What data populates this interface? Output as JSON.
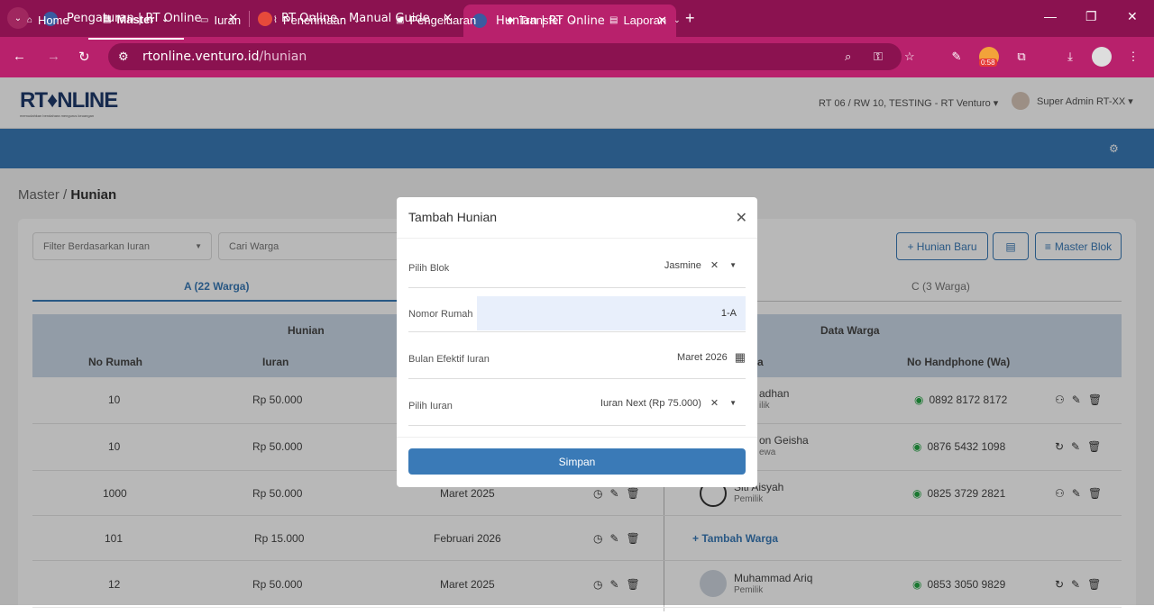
{
  "browser": {
    "tabs": [
      {
        "title": "Pengaturan | RT Online"
      },
      {
        "title": "RT Online - Manual Guide - Xm"
      },
      {
        "title": "Hunian | RT Online"
      }
    ],
    "url_host": "rtonline.venturo.id",
    "url_path": "/hunian",
    "timer": "0:58"
  },
  "app": {
    "logo": "RT♦NLINE",
    "logo_sub": "memudahkan bendahara mengurus keuangan",
    "rt_selector": "RT 06 / RW 10, TESTING - RT Venturo ▾",
    "user": "Super Admin RT-XX ▾"
  },
  "menu": [
    {
      "label": "Home"
    },
    {
      "label": "Master"
    },
    {
      "label": "Iuran"
    },
    {
      "label": "Penerimaan"
    },
    {
      "label": "Pengeluaran"
    },
    {
      "label": "Transfer"
    },
    {
      "label": "Laporan"
    }
  ],
  "breadcrumb": {
    "parent": "Master",
    "current": "Hunian"
  },
  "filters": {
    "filter_iuran": "Filter Berdasarkan Iuran",
    "search": "Cari Warga"
  },
  "buttons": {
    "new": "+ Hunian Baru",
    "master_blok": "Master Blok"
  },
  "block_tabs": [
    "A (22 Warga)",
    "C (3 Warga)"
  ],
  "table": {
    "group_hunian": "Hunian",
    "group_warga": "Data Warga",
    "col_no": "No Rumah",
    "col_iuran": "Iuran",
    "col_name": "a",
    "col_phone": "No Handphone (Wa)",
    "rows": [
      {
        "no": "10",
        "iuran": "Rp 50.000",
        "bulan": "",
        "name": "adhan",
        "role": "ilik",
        "phone": "0892 8172 8172"
      },
      {
        "no": "10",
        "iuran": "Rp 50.000",
        "bulan": "",
        "name": "on Geisha",
        "role": "ewa",
        "phone": "0876 5432 1098"
      },
      {
        "no": "1000",
        "iuran": "Rp 50.000",
        "bulan": "Maret 2025",
        "name": "Siti Aisyah",
        "role": "Pemilik",
        "phone": "0825 3729 2821"
      },
      {
        "no": "101",
        "iuran": "Rp 15.000",
        "bulan": "Februari 2026",
        "name": "+ Tambah Warga",
        "role": "",
        "phone": ""
      },
      {
        "no": "12",
        "iuran": "Rp 50.000",
        "bulan": "Maret 2025",
        "name": "Muhammad Ariq",
        "role": "Pemilik",
        "phone": "0853 3050 9829"
      }
    ]
  },
  "modal": {
    "title": "Tambah Hunian",
    "blok_label": "Pilih Blok",
    "blok_value": "Jasmine",
    "nomor_label": "Nomor Rumah",
    "nomor_value": "1-A",
    "bulan_label": "Bulan Efektif Iuran",
    "bulan_value": "Maret 2026",
    "iuran_label": "Pilih Iuran",
    "iuran_value": "Iuran Next (Rp 75.000)",
    "save": "Simpan"
  }
}
